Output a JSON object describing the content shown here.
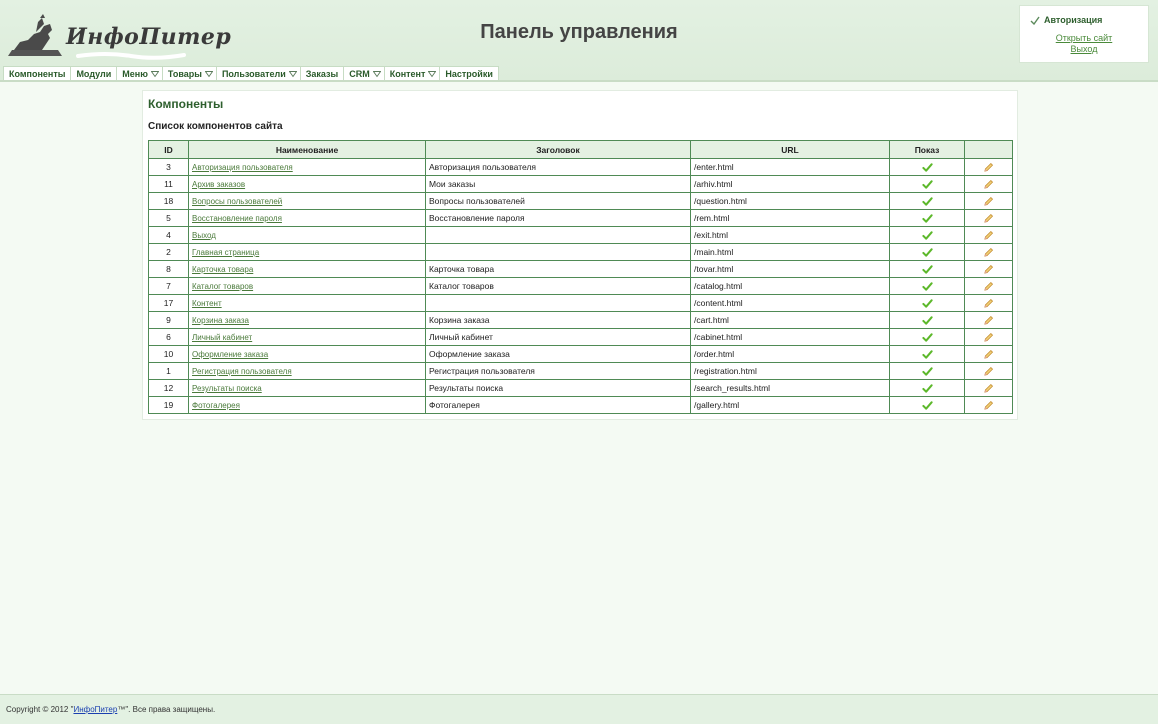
{
  "header": {
    "logo_text": "ИнфоПитер",
    "page_title": "Панель управления"
  },
  "auth": {
    "title": "Авторизация",
    "open_site": "Открыть сайт",
    "logout": "Выход"
  },
  "nav": [
    {
      "label": "Компоненты",
      "dropdown": false
    },
    {
      "label": "Модули",
      "dropdown": false
    },
    {
      "label": "Меню",
      "dropdown": true
    },
    {
      "label": "Товары",
      "dropdown": true
    },
    {
      "label": "Пользователи",
      "dropdown": true
    },
    {
      "label": "Заказы",
      "dropdown": false
    },
    {
      "label": "CRM",
      "dropdown": true
    },
    {
      "label": "Контент",
      "dropdown": true
    },
    {
      "label": "Настройки",
      "dropdown": false
    }
  ],
  "main": {
    "title": "Компоненты",
    "subtitle": "Список компонентов сайта",
    "columns": [
      "ID",
      "Наименование",
      "Заголовок",
      "URL",
      "Показ",
      ""
    ],
    "rows": [
      {
        "id": "3",
        "name": "Авторизация пользователя",
        "title": "Авторизация пользователя",
        "url": "/enter.html"
      },
      {
        "id": "11",
        "name": "Архив заказов",
        "title": "Мои заказы",
        "url": "/arhiv.html"
      },
      {
        "id": "18",
        "name": "Вопросы пользователей",
        "title": "Вопросы пользователей",
        "url": "/question.html"
      },
      {
        "id": "5",
        "name": "Восстановление пароля",
        "title": "Восстановление пароля",
        "url": "/rem.html"
      },
      {
        "id": "4",
        "name": "Выход",
        "title": "",
        "url": "/exit.html"
      },
      {
        "id": "2",
        "name": "Главная страница",
        "title": "",
        "url": "/main.html"
      },
      {
        "id": "8",
        "name": "Карточка товара",
        "title": "Карточка товара",
        "url": "/tovar.html"
      },
      {
        "id": "7",
        "name": "Каталог товаров",
        "title": "Каталог товаров",
        "url": "/catalog.html"
      },
      {
        "id": "17",
        "name": "Контент",
        "title": "",
        "url": "/content.html"
      },
      {
        "id": "9",
        "name": "Корзина заказа",
        "title": "Корзина заказа",
        "url": "/cart.html"
      },
      {
        "id": "6",
        "name": "Личный кабинет",
        "title": "Личный кабинет",
        "url": "/cabinet.html"
      },
      {
        "id": "10",
        "name": "Оформление заказа",
        "title": "Оформление заказа",
        "url": "/order.html"
      },
      {
        "id": "1",
        "name": "Регистрация пользователя",
        "title": "Регистрация пользователя",
        "url": "/registration.html"
      },
      {
        "id": "12",
        "name": "Результаты поиска",
        "title": "Результаты поиска",
        "url": "/search_results.html"
      },
      {
        "id": "19",
        "name": "Фотогалерея",
        "title": "Фотогалерея",
        "url": "/gallery.html"
      }
    ]
  },
  "footer": {
    "prefix": "Copyright © 2012 \"",
    "brand_link": "ИнфоПитер",
    "suffix": "™\". Все права защищены."
  },
  "icons": {
    "show": "check-icon",
    "edit": "pencil-icon",
    "auth": "checkmark-icon",
    "dropdown": "triangle-down-icon"
  },
  "colors": {
    "accent_green": "#2e5f2e",
    "link_green": "#4a7a3a",
    "header_bg": "#e3f1e2",
    "table_border": "#4f8a55",
    "check_green": "#5cb82a"
  }
}
